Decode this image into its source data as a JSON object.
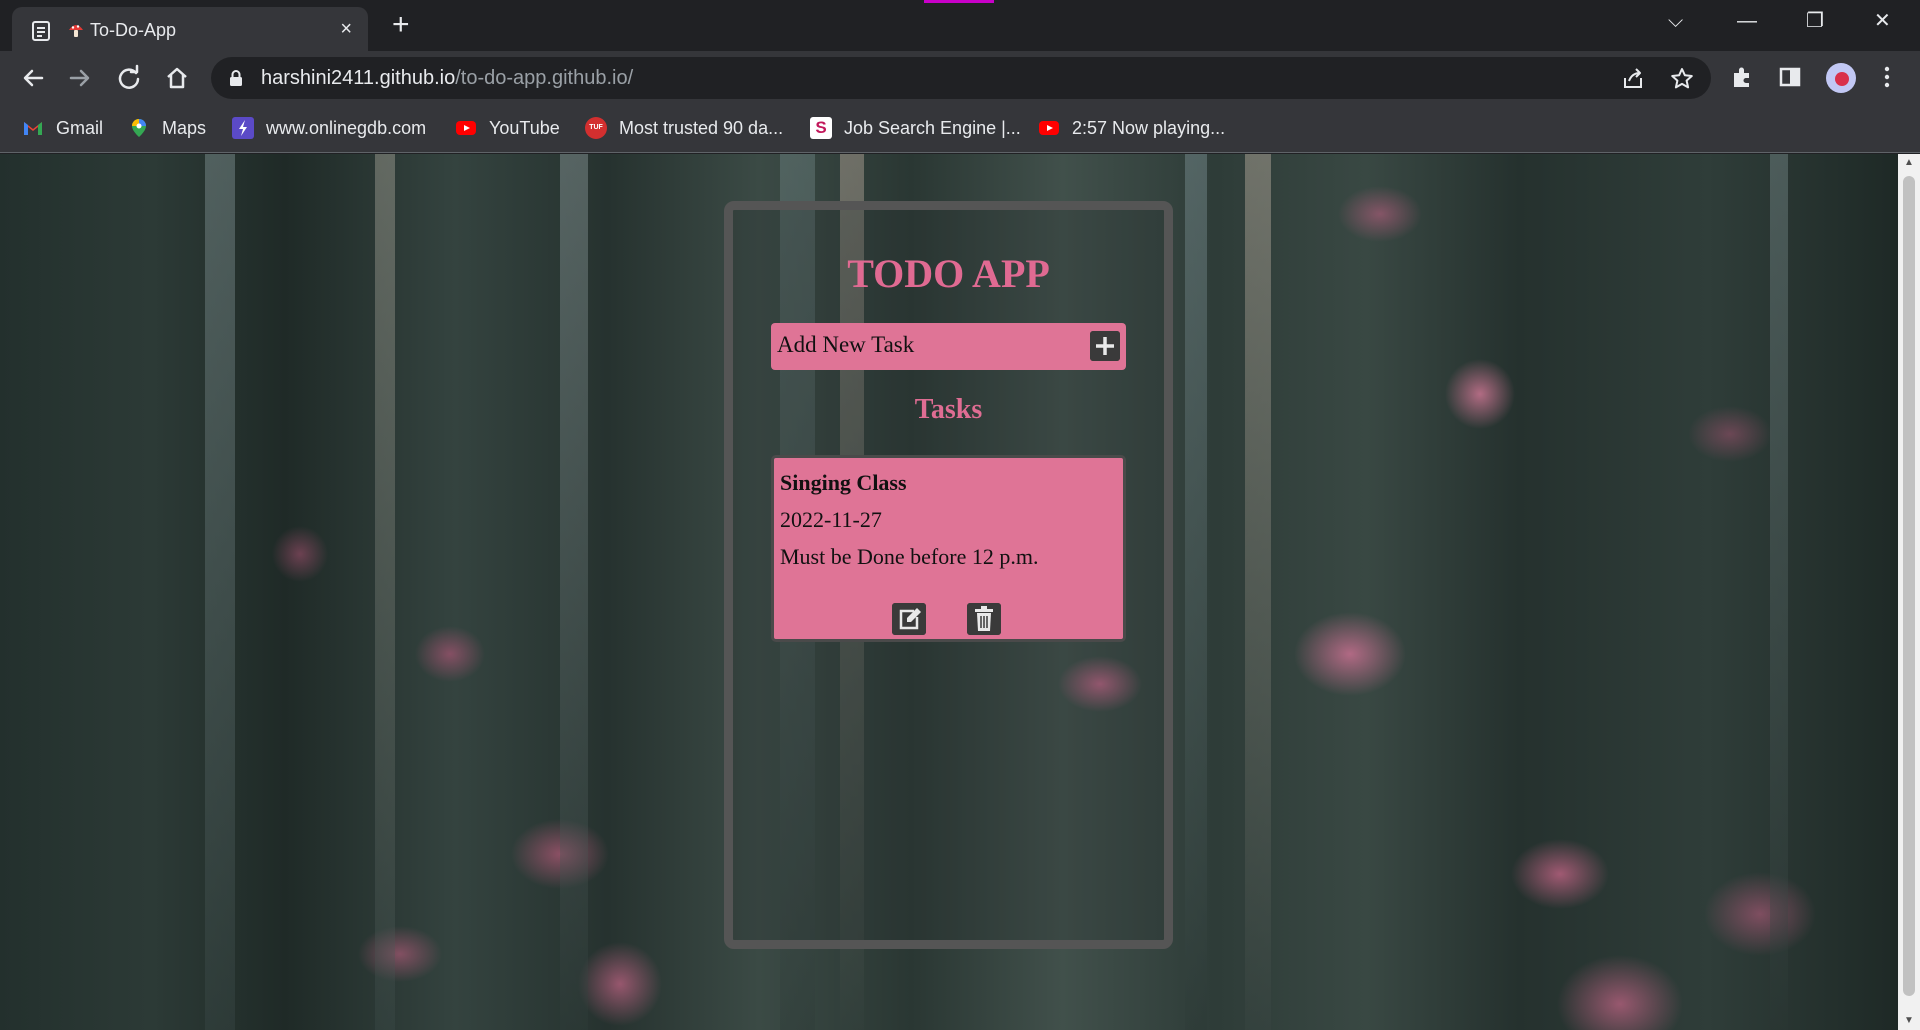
{
  "browser": {
    "tab_title": "To-Do-App",
    "close_glyph": "×",
    "new_tab_glyph": "+",
    "url_host": "harshini2411.github.io",
    "url_path": "/to-do-app.github.io/",
    "window_controls": {
      "dropdown": "⌵",
      "minimize": "—",
      "restore": "❐",
      "close": "✕"
    },
    "bookmarks": [
      {
        "label": "Gmail",
        "icon": "gmail-icon"
      },
      {
        "label": "Maps",
        "icon": "maps-icon"
      },
      {
        "label": "www.onlinegdb.com",
        "icon": "onlinegdb-icon"
      },
      {
        "label": "YouTube",
        "icon": "youtube-icon"
      },
      {
        "label": "Most trusted 90 da...",
        "icon": "tuf-icon"
      },
      {
        "label": "Job Search Engine |...",
        "icon": "job-search-icon"
      },
      {
        "label": "2:57 Now playing...",
        "icon": "youtube-icon"
      }
    ],
    "tuf_badge_text": "TUF",
    "job_badge_text": "S"
  },
  "app": {
    "title": "TODO APP",
    "add_placeholder": "Add New Task",
    "tasks_heading": "Tasks",
    "tasks": [
      {
        "name": "Singing Class",
        "date": "2022-11-27",
        "description": "Must be Done before 12 p.m."
      }
    ]
  },
  "colors": {
    "accent_pink": "#df7496",
    "title_pink": "#e06a92",
    "card_border": "#555555",
    "chrome_dark": "#202124",
    "chrome_mid": "#35363a"
  }
}
